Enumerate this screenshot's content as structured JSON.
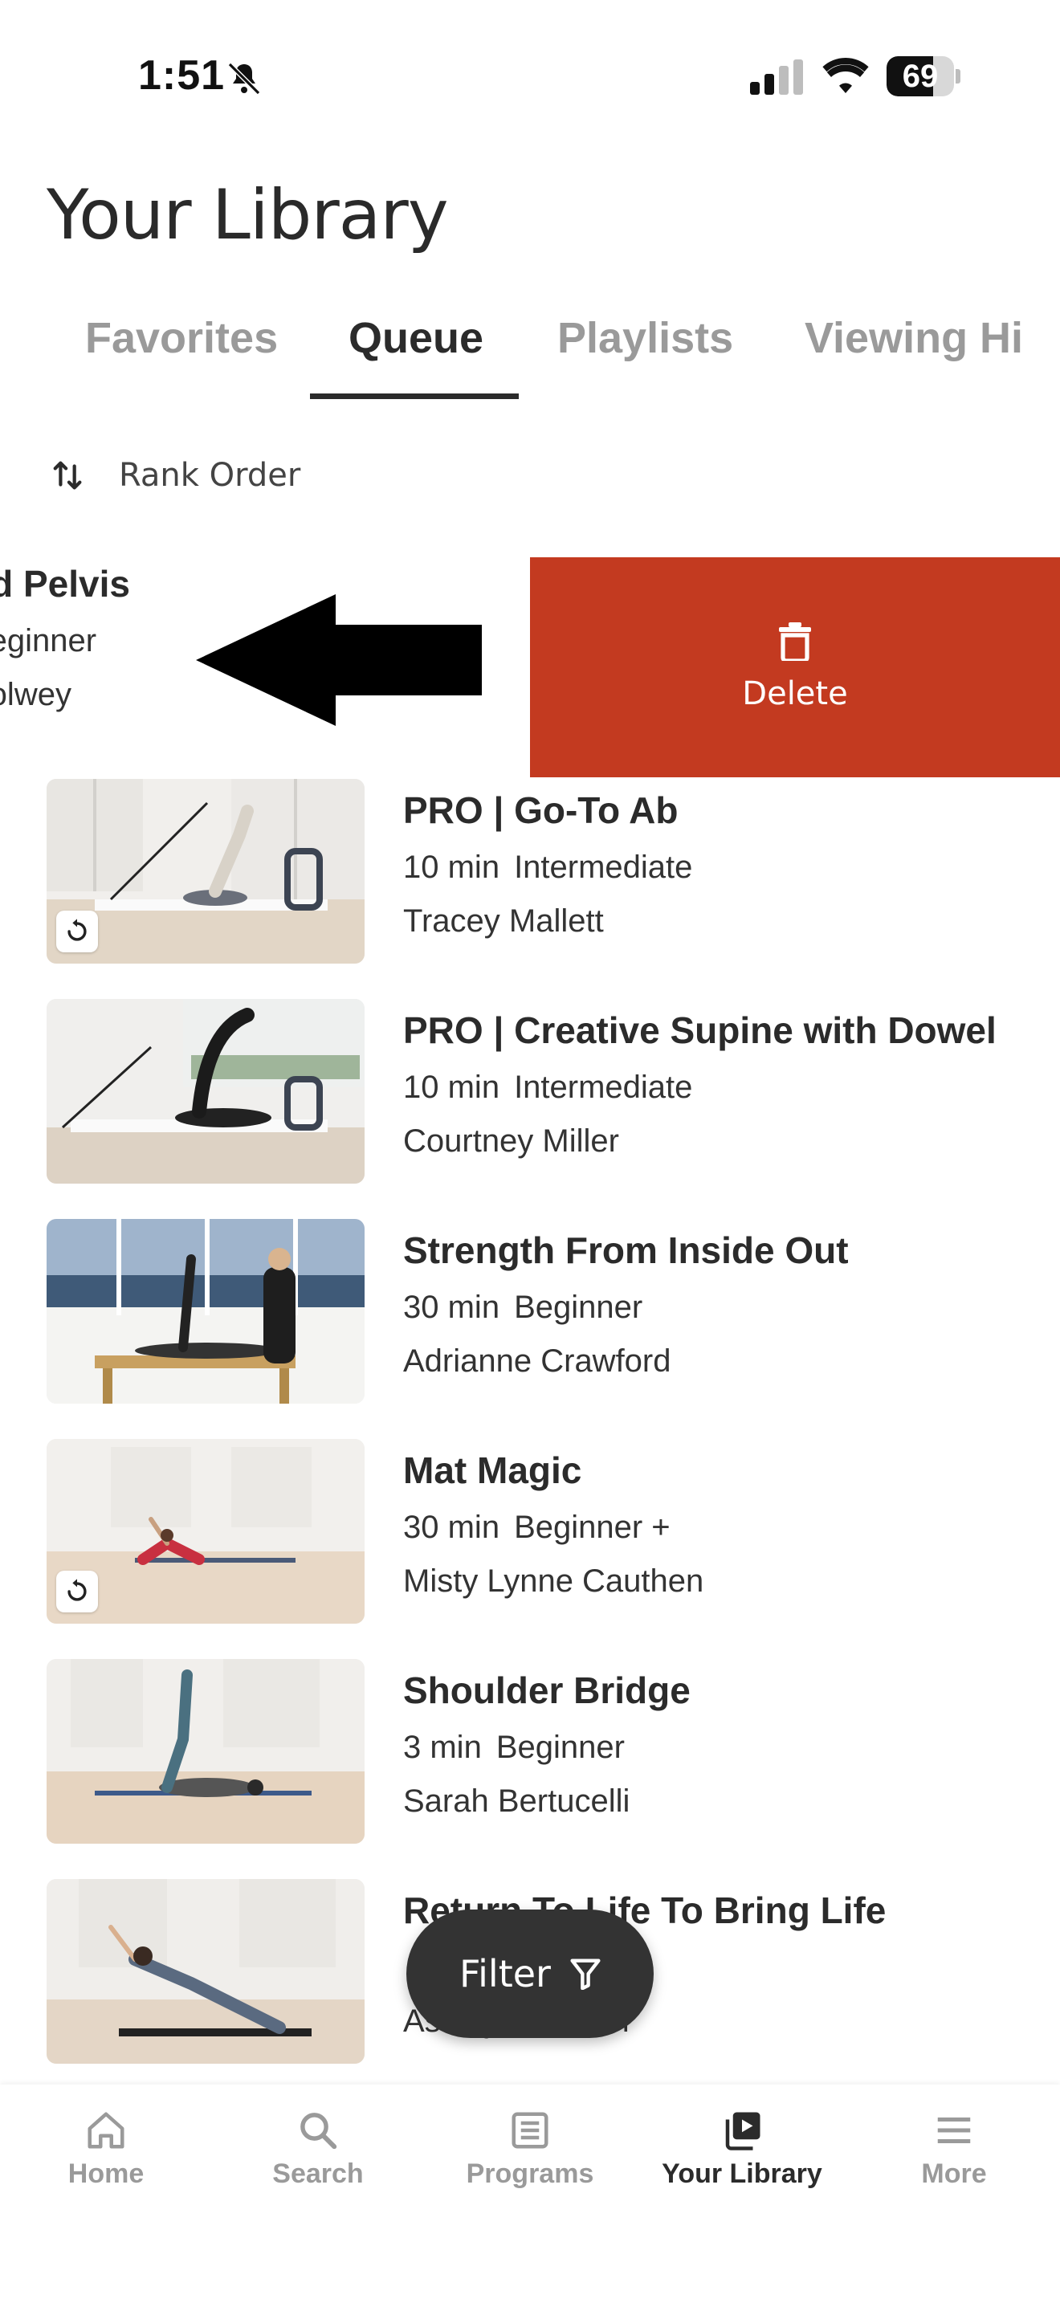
{
  "status_bar": {
    "time": "1:51",
    "battery": "69",
    "battery_level": 0.69
  },
  "header": {
    "title": "Your Library"
  },
  "tabs": [
    {
      "label": "Favorites"
    },
    {
      "label": "Queue"
    },
    {
      "label": "Playlists"
    },
    {
      "label": "Viewing Hi"
    }
  ],
  "active_tab": "Queue",
  "sort": {
    "label": "Rank Order"
  },
  "swiped_item": {
    "title": "nd Pelvis",
    "level": "Beginner",
    "instructor": "Kolwey",
    "delete_label": "Delete",
    "delete_color": "#c33a20"
  },
  "items": [
    {
      "title": "PRO | Go-To Ab",
      "duration": "10 min",
      "level": "Intermediate",
      "instructor": "Tracey Mallett",
      "replay": true
    },
    {
      "title": "PRO | Creative Supine with Dowel",
      "duration": "10 min",
      "level": "Intermediate",
      "instructor": "Courtney Miller",
      "replay": false
    },
    {
      "title": "Strength From Inside Out",
      "duration": "30 min",
      "level": "Beginner",
      "instructor": "Adrianne Crawford",
      "replay": false
    },
    {
      "title": "Mat Magic",
      "duration": "30 min",
      "level": "Beginner +",
      "instructor": "Misty Lynne Cauthen",
      "replay": true
    },
    {
      "title": "Shoulder Bridge",
      "duration": "3 min",
      "level": "Beginner",
      "instructor": "Sarah Bertucelli",
      "replay": false
    },
    {
      "title": "Return To Life To Bring Life",
      "duration": "",
      "level": "",
      "instructor": "Ashley Hoffman",
      "replay": false
    }
  ],
  "filter": {
    "label": "Filter"
  },
  "bottom_nav": [
    {
      "label": "Home",
      "icon": "home-icon"
    },
    {
      "label": "Search",
      "icon": "search-icon"
    },
    {
      "label": "Programs",
      "icon": "programs-icon"
    },
    {
      "label": "Your Library",
      "icon": "library-icon"
    },
    {
      "label": "More",
      "icon": "menu-icon"
    }
  ],
  "active_nav": "Your Library"
}
